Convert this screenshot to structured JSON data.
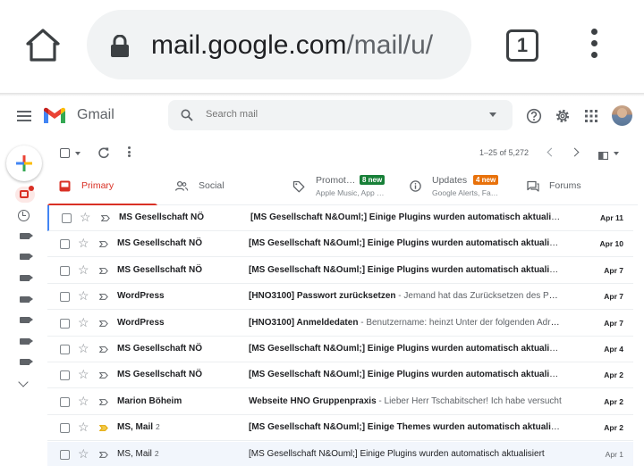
{
  "browser": {
    "url_host": "mail.google.com",
    "url_path": "/mail/u/",
    "tab_count": "1"
  },
  "header": {
    "app_name": "Gmail",
    "search_placeholder": "Search mail"
  },
  "toolbar": {
    "range": "1–25 of 5,272"
  },
  "tabs": {
    "primary": {
      "label": "Primary"
    },
    "social": {
      "label": "Social"
    },
    "promotions": {
      "label": "Promot…",
      "badge": "8 new",
      "sub": "Apple Music, App …",
      "badge_color": "#188038"
    },
    "updates": {
      "label": "Updates",
      "badge": "4 new",
      "sub": "Google Alerts, Fa…",
      "badge_color": "#e8710a"
    },
    "forums": {
      "label": "Forums"
    }
  },
  "messages": [
    {
      "sender": "MS Gesellschaft NÖ",
      "count": "",
      "subject": "[MS Gesellschaft N&Ouml;] Einige Plugins wurden automatisch aktualisiert",
      "snippet": "",
      "date": "Apr 11",
      "unread": true
    },
    {
      "sender": "MS Gesellschaft NÖ",
      "count": "",
      "subject": "[MS Gesellschaft N&Ouml;] Einige Plugins wurden automatisch aktualisiert",
      "snippet": "",
      "date": "Apr 10",
      "unread": true
    },
    {
      "sender": "MS Gesellschaft NÖ",
      "count": "",
      "subject": "[MS Gesellschaft N&Ouml;] Einige Plugins wurden automatisch aktualisiert",
      "snippet": "",
      "date": "Apr 7",
      "unread": true
    },
    {
      "sender": "WordPress",
      "count": "",
      "subject": "[HNO3100] Passwort zurücksetzen",
      "snippet": " - Jemand hat das Zurücksetzen des Passworts angefordert",
      "date": "Apr 7",
      "unread": true
    },
    {
      "sender": "WordPress",
      "count": "",
      "subject": "[HNO3100] Anmeldedaten",
      "snippet": " - Benutzername: heinzt Unter der folgenden Adresse",
      "date": "Apr 7",
      "unread": true
    },
    {
      "sender": "MS Gesellschaft NÖ",
      "count": "",
      "subject": "[MS Gesellschaft N&Ouml;] Einige Plugins wurden automatisch aktualisiert",
      "snippet": "",
      "date": "Apr 4",
      "unread": true
    },
    {
      "sender": "MS Gesellschaft NÖ",
      "count": "",
      "subject": "[MS Gesellschaft N&Ouml;] Einige Plugins wurden automatisch aktualisiert",
      "snippet": "",
      "date": "Apr 2",
      "unread": true
    },
    {
      "sender": "Marion Böheim",
      "count": "",
      "subject": "Webseite HNO Gruppenpraxis",
      "snippet": " - Lieber Herr Tschabitscher! Ich habe versucht",
      "date": "Apr 2",
      "unread": true
    },
    {
      "sender": "MS, Mail",
      "count": "2",
      "subject": "[MS Gesellschaft N&Ouml;] Einige Themes wurden automatisch aktualisiert",
      "snippet": "",
      "date": "Apr 2",
      "unread": true,
      "important": true
    },
    {
      "sender": "MS, Mail",
      "count": "2",
      "subject": "[MS Gesellschaft N&Ouml;] Einige Plugins wurden automatisch aktualisiert",
      "snippet": "",
      "date": "Apr 1",
      "unread": false
    }
  ]
}
